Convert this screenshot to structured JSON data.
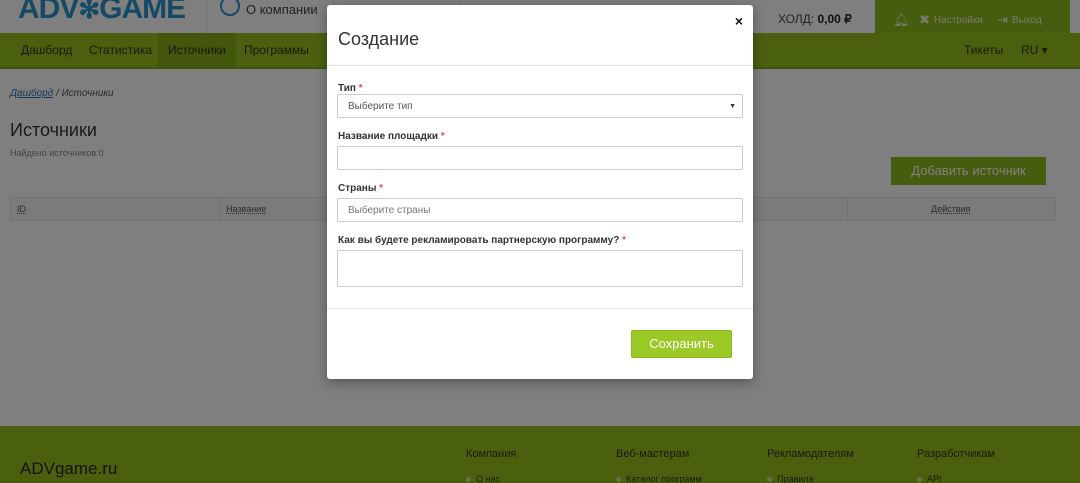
{
  "topbar": {
    "logo_left": "ADV",
    "logo_right": "GAME",
    "about_label": "О компании",
    "hold_label": "ХОЛД:",
    "hold_value": "0,00 ₽",
    "settings_label": "Настройки",
    "logout_label": "Выход"
  },
  "nav": {
    "items": [
      "Дашборд",
      "Статистика",
      "Источники",
      "Программы"
    ],
    "tickets": "Тикеты",
    "lang": "RU ▾"
  },
  "page": {
    "crumb_home": "Дашборд",
    "crumb_current": "Источники",
    "title": "Источники",
    "found": "Найдено источников:0",
    "add_button": "Добавить источник",
    "columns": {
      "id": "ID",
      "name": "Название",
      "actions": "Действия"
    }
  },
  "footer": {
    "brand": "ADVgame.ru",
    "columns": [
      "Компания",
      "Веб-мастерам",
      "Рекламодателям",
      "Разработчикам"
    ],
    "links": [
      "О нас",
      "Каталог программ",
      "Правила",
      "API"
    ]
  },
  "modal": {
    "title": "Создание",
    "close": "×",
    "type_label": "Тип",
    "type_placeholder": "Выберите тип",
    "site_label": "Название площадки",
    "countries_label": "Страны",
    "countries_placeholder": "Выберите страны",
    "promo_label": "Как вы будете рекламировать партнерскую программу?",
    "required_mark": "*",
    "save_button": "Сохранить"
  }
}
